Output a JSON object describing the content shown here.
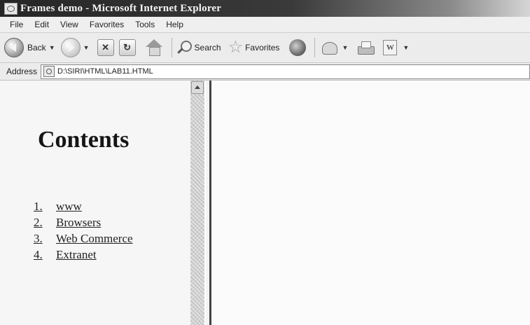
{
  "window": {
    "title": "Frames demo - Microsoft Internet Explorer"
  },
  "menu": [
    "File",
    "Edit",
    "View",
    "Favorites",
    "Tools",
    "Help"
  ],
  "toolbar": {
    "back_label": "Back",
    "search_label": "Search",
    "favorites_label": "Favorites",
    "icons": [
      "back-icon",
      "forward-icon",
      "stop-icon",
      "refresh-icon",
      "home-icon",
      "search-icon",
      "favorites-star-icon",
      "media-icon",
      "mail-icon",
      "print-icon",
      "edit-icon"
    ]
  },
  "address": {
    "label": "Address",
    "value": "D:\\SIRI\\HTML\\LAB11.HTML"
  },
  "left_frame": {
    "heading": "Contents",
    "items": [
      {
        "num": "1.",
        "label": "www"
      },
      {
        "num": "2.",
        "label": "Browsers"
      },
      {
        "num": "3.",
        "label": "Web Commerce"
      },
      {
        "num": "4.",
        "label": "Extranet"
      }
    ]
  }
}
